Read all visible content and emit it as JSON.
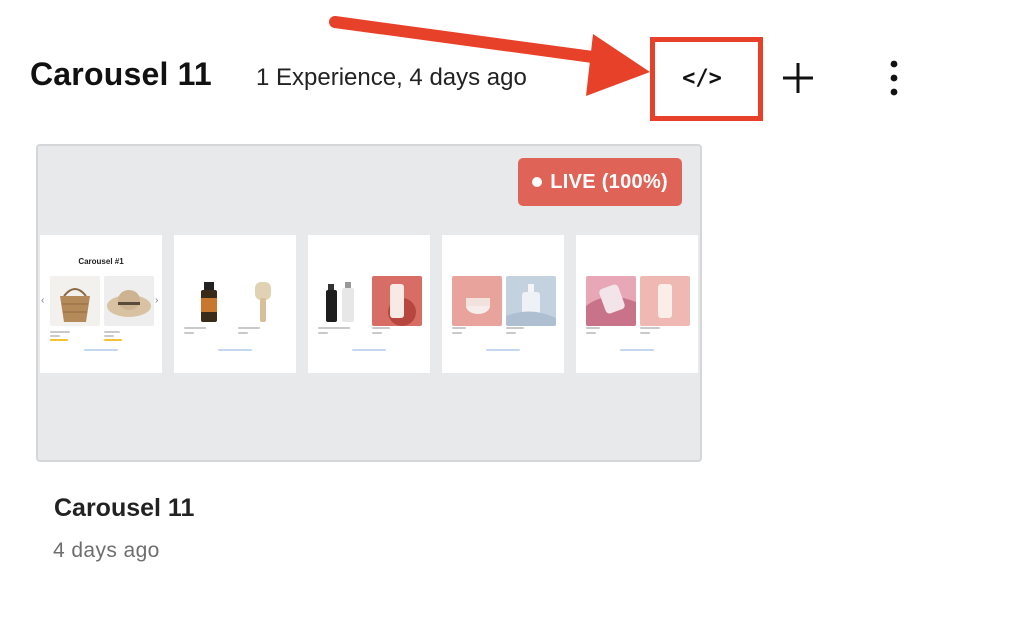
{
  "header": {
    "title": "Carousel 11",
    "meta": "1 Experience, 4 days ago",
    "embed_code_label": "</>",
    "add_icon": "plus-icon",
    "more_icon": "kebab-vertical-icon"
  },
  "annotation": {
    "color": "#e8412a"
  },
  "card": {
    "badge": "LIVE (100%)",
    "badge_color": "#df6457",
    "preview_slides": [
      {
        "title": "Carousel #1",
        "images": [
          "straw-bag",
          "straw-hat"
        ]
      },
      {
        "title": "",
        "images": [
          "bronze-bottle",
          "wooden-brush"
        ]
      },
      {
        "title": "",
        "images": [
          "black-white-bottles",
          "cream-tube-pink"
        ]
      },
      {
        "title": "",
        "images": [
          "pink-jar",
          "blue-pump-bottle"
        ]
      },
      {
        "title": "",
        "images": [
          "pink-product-swirl",
          "cream-tube-peach"
        ]
      }
    ],
    "title": "Carousel 11",
    "date": "4 days ago"
  }
}
